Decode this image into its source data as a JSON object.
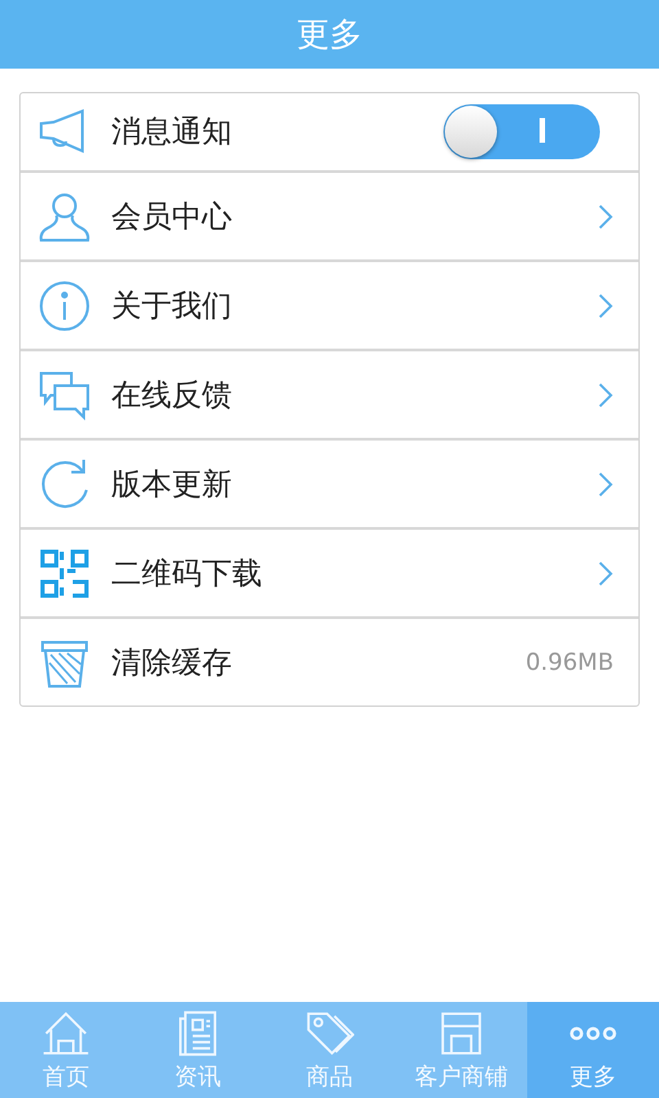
{
  "header": {
    "title": "更多"
  },
  "items": [
    {
      "kind": "toggle",
      "label": "消息通知",
      "on": true
    },
    {
      "kind": "link",
      "label": "会员中心"
    },
    {
      "kind": "link",
      "label": "关于我们"
    },
    {
      "kind": "link",
      "label": "在线反馈"
    },
    {
      "kind": "link",
      "label": "版本更新"
    },
    {
      "kind": "link",
      "label": "二维码下载"
    },
    {
      "kind": "value",
      "label": "清除缓存",
      "value": "0.96MB"
    }
  ],
  "tabs": [
    {
      "label": "首页",
      "selected": false
    },
    {
      "label": "资讯",
      "selected": false
    },
    {
      "label": "商品",
      "selected": false
    },
    {
      "label": "客户商铺",
      "selected": false
    },
    {
      "label": "更多",
      "selected": true
    }
  ]
}
